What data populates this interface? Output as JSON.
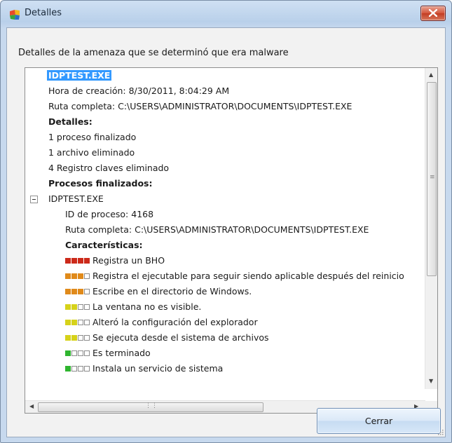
{
  "window": {
    "title": "Detalles"
  },
  "dialog": {
    "description": "Detalles de la amenaza que se determinó que era malware",
    "close_button_label": "Cerrar"
  },
  "tree": {
    "file_name": "IDPTEST.EXE",
    "created": "Hora de creación: 8/30/2011, 8:04:29 AM",
    "path": "Ruta completa: C:\\USERS\\ADMINISTRATOR\\DOCUMENTS\\IDPTEST.EXE",
    "details_heading": "Detalles:",
    "details": [
      "1 proceso finalizado",
      "1 archivo eliminado",
      "4 Registro claves eliminado"
    ],
    "processes_heading": "Procesos finalizados:",
    "process": {
      "name": "IDPTEST.EXE",
      "pid": "ID de proceso: 4168",
      "path": "Ruta completa: C:\\USERS\\ADMINISTRATOR\\DOCUMENTS\\IDPTEST.EXE",
      "characteristics_heading": "Características:",
      "characteristics": [
        {
          "label": "Registra un BHO",
          "level": 4,
          "color": "#cc2a1a"
        },
        {
          "label": "Registra el ejecutable para seguir siendo aplicable después del reinicio",
          "level": 3,
          "color": "#e08a1a"
        },
        {
          "label": "Escribe en el directorio de Windows.",
          "level": 3,
          "color": "#e08a1a"
        },
        {
          "label": "La ventana no es visible.",
          "level": 2,
          "color": "#d6d21a"
        },
        {
          "label": "Alteró la configuración del explorador",
          "level": 2,
          "color": "#d6d21a"
        },
        {
          "label": "Se ejecuta desde el sistema de archivos",
          "level": 2,
          "color": "#d6d21a"
        },
        {
          "label": "Es terminado",
          "level": 1,
          "color": "#2fb52f"
        },
        {
          "label": "Instala un servicio de sistema",
          "level": 1,
          "color": "#2fb52f"
        }
      ]
    }
  },
  "icons": {
    "app": "avg-logo-icon",
    "close": "close-icon",
    "collapse": "collapse-minus-icon"
  }
}
